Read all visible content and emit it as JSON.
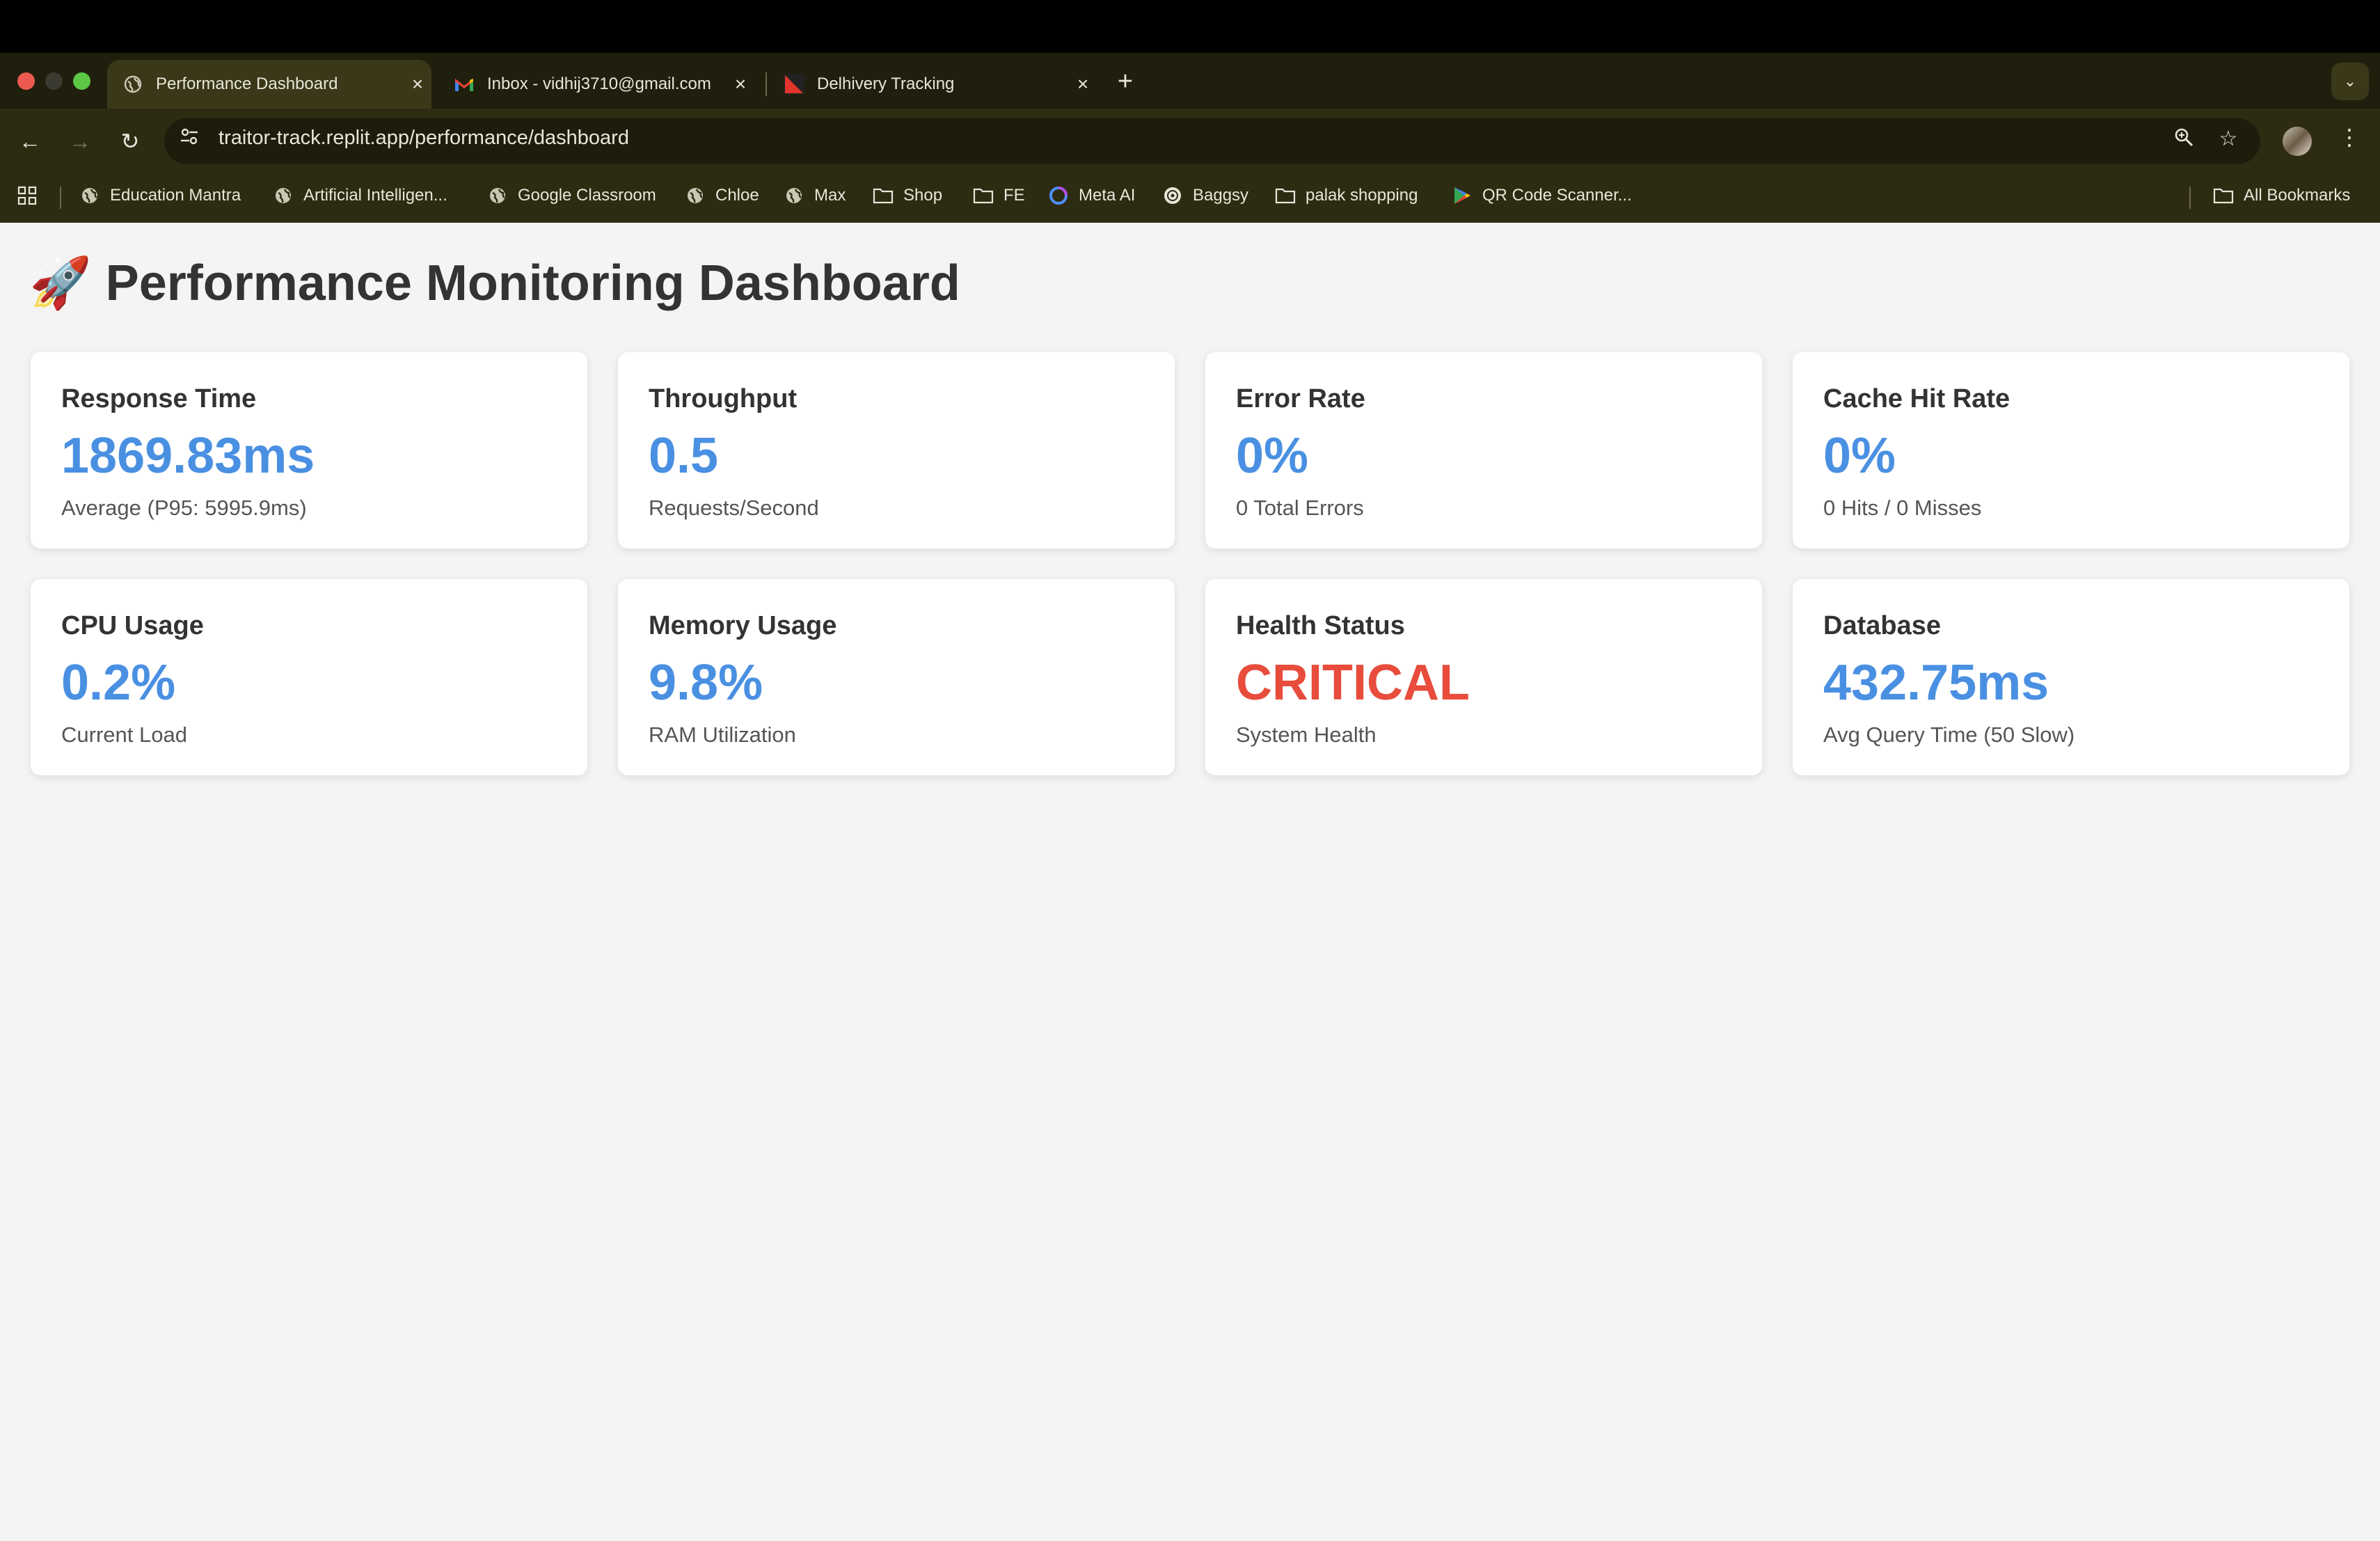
{
  "browser": {
    "tabs": [
      {
        "title": "Performance Dashboard",
        "icon": "globe-icon",
        "active": true
      },
      {
        "title": "Inbox - vidhij3710@gmail.com",
        "icon": "gmail-icon",
        "active": false
      },
      {
        "title": "Delhivery Tracking",
        "icon": "delhivery-icon",
        "active": false
      }
    ],
    "new_tab_label": "+",
    "url": "traitor-track.replit.app/performance/dashboard",
    "bookmarks": [
      {
        "label": "Education Mantra",
        "icon": "globe-icon"
      },
      {
        "label": "Artificial Intelligen...",
        "icon": "globe-icon"
      },
      {
        "label": "Google Classroom",
        "icon": "globe-icon"
      },
      {
        "label": "Chloe",
        "icon": "globe-icon"
      },
      {
        "label": "Max",
        "icon": "globe-icon"
      },
      {
        "label": "Shop",
        "icon": "folder-icon"
      },
      {
        "label": "FE",
        "icon": "folder-icon"
      },
      {
        "label": "Meta AI",
        "icon": "meta-ai-icon"
      },
      {
        "label": "Baggsy",
        "icon": "baggsy-icon"
      },
      {
        "label": "palak shopping",
        "icon": "folder-icon"
      },
      {
        "label": "QR Code Scanner...",
        "icon": "play-store-icon"
      }
    ],
    "all_bookmarks_label": "All Bookmarks"
  },
  "page": {
    "title_emoji": "🚀",
    "title": "Performance Monitoring Dashboard"
  },
  "metrics": [
    {
      "title": "Response Time",
      "value": "1869.83ms",
      "sub": "Average (P95: 5995.9ms)"
    },
    {
      "title": "Throughput",
      "value": "0.5",
      "sub": "Requests/Second"
    },
    {
      "title": "Error Rate",
      "value": "0%",
      "sub": "0 Total Errors"
    },
    {
      "title": "Cache Hit Rate",
      "value": "0%",
      "sub": "0 Hits / 0 Misses"
    },
    {
      "title": "CPU Usage",
      "value": "0.2%",
      "sub": "Current Load"
    },
    {
      "title": "Memory Usage",
      "value": "9.8%",
      "sub": "RAM Utilization"
    },
    {
      "title": "Health Status",
      "value": "CRITICAL",
      "sub": "System Health"
    },
    {
      "title": "Database",
      "value": "432.75ms",
      "sub": "Avg Query Time (50 Slow)"
    }
  ],
  "colors": {
    "value_blue": "#4a90e2",
    "critical_red": "#e74c3c",
    "chrome_bg": "#2e2b13"
  }
}
